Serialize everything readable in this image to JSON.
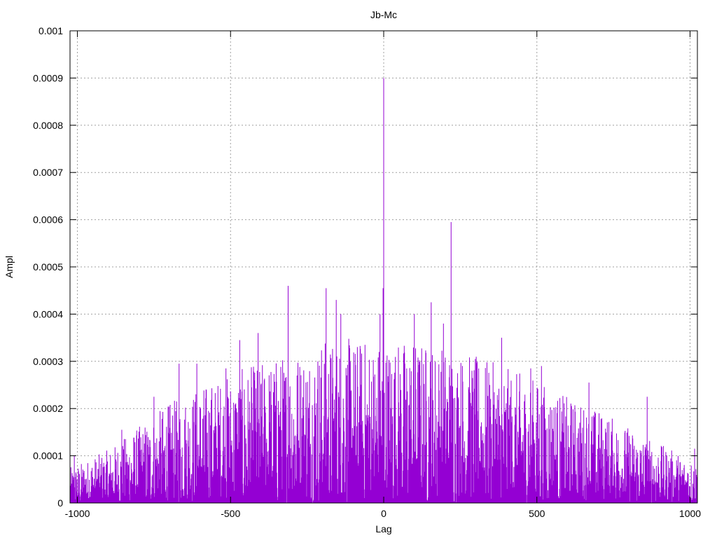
{
  "chart_data": {
    "type": "line",
    "title": "Jb-Mc",
    "xlabel": "Lag",
    "ylabel": "Ampl",
    "xlim": [
      -1024,
      1024
    ],
    "ylim": [
      0,
      0.001
    ],
    "x_ticks": [
      -1000,
      -500,
      0,
      500,
      1000
    ],
    "x_tick_labels": [
      "-1000",
      "-500",
      "0",
      "500",
      "1000"
    ],
    "y_ticks": [
      0,
      0.0001,
      0.0002,
      0.0003,
      0.0004,
      0.0005,
      0.0006,
      0.0007,
      0.0008,
      0.0009,
      0.001
    ],
    "y_tick_labels": [
      "0",
      "0.0001",
      "0.0002",
      "0.0003",
      "0.0004",
      "0.0005",
      "0.0006",
      "0.0007",
      "0.0008",
      "0.0009",
      "0.001"
    ],
    "grid": true,
    "line_color": "#9400d3",
    "series": [
      {
        "style": "impulses",
        "peaks": [
          {
            "x": 0,
            "y": 0.0009
          },
          {
            "x": -2,
            "y": 0.000455
          },
          {
            "x": -12,
            "y": 0.0004
          },
          {
            "x": 220,
            "y": 0.000595
          },
          {
            "x": -312,
            "y": 0.00046
          },
          {
            "x": -188,
            "y": 0.000455
          },
          {
            "x": -155,
            "y": 0.00043
          },
          {
            "x": -140,
            "y": 0.0004
          },
          {
            "x": 155,
            "y": 0.000425
          },
          {
            "x": 195,
            "y": 0.00038
          },
          {
            "x": 100,
            "y": 0.0004
          },
          {
            "x": 385,
            "y": 0.00035
          },
          {
            "x": -410,
            "y": 0.00036
          },
          {
            "x": -470,
            "y": 0.000345
          },
          {
            "x": -668,
            "y": 0.000295
          },
          {
            "x": -610,
            "y": 0.000295
          },
          {
            "x": -515,
            "y": 0.000285
          },
          {
            "x": 480,
            "y": 0.000285
          },
          {
            "x": 515,
            "y": 0.00029
          },
          {
            "x": 670,
            "y": 0.000255
          },
          {
            "x": 860,
            "y": 0.000225
          },
          {
            "x": -750,
            "y": 0.000225
          },
          {
            "x": -855,
            "y": 0.000155
          },
          {
            "x": -1010,
            "y": 0.0001
          },
          {
            "x": 1015,
            "y": 0.000115
          }
        ],
        "envelope": [
          {
            "x": -1024,
            "y": 6e-05
          },
          {
            "x": -900,
            "y": 9e-05
          },
          {
            "x": -800,
            "y": 0.00013
          },
          {
            "x": -700,
            "y": 0.00017
          },
          {
            "x": -600,
            "y": 0.0002
          },
          {
            "x": -500,
            "y": 0.00022
          },
          {
            "x": -400,
            "y": 0.00024
          },
          {
            "x": -300,
            "y": 0.00026
          },
          {
            "x": -200,
            "y": 0.00028
          },
          {
            "x": -100,
            "y": 0.00028
          },
          {
            "x": 0,
            "y": 0.00028
          },
          {
            "x": 100,
            "y": 0.00028
          },
          {
            "x": 200,
            "y": 0.00027
          },
          {
            "x": 300,
            "y": 0.00025
          },
          {
            "x": 400,
            "y": 0.00023
          },
          {
            "x": 500,
            "y": 0.00021
          },
          {
            "x": 600,
            "y": 0.00018
          },
          {
            "x": 700,
            "y": 0.00016
          },
          {
            "x": 800,
            "y": 0.00013
          },
          {
            "x": 900,
            "y": 0.0001
          },
          {
            "x": 1024,
            "y": 7e-05
          }
        ]
      }
    ]
  }
}
